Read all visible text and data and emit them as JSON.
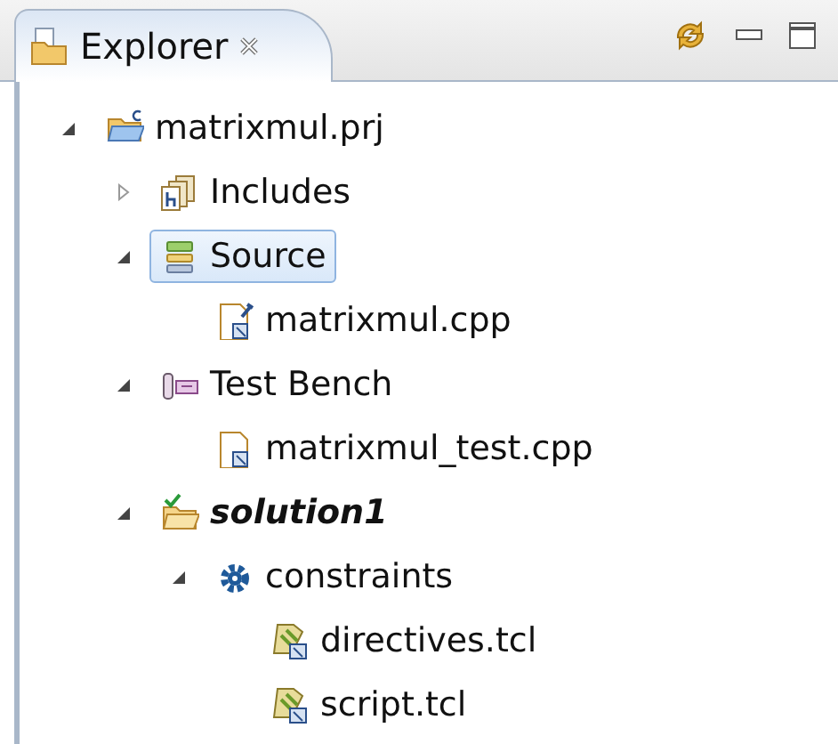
{
  "tab": {
    "label": "Explorer",
    "selected": true,
    "closable": true
  },
  "tree": [
    {
      "label": "matrixmul.prj",
      "kind": "project",
      "expanded": true,
      "selected": false,
      "active": false,
      "children": [
        {
          "label": "Includes",
          "kind": "includes",
          "expanded": false,
          "selected": false,
          "active": false
        },
        {
          "label": "Source",
          "kind": "source",
          "expanded": true,
          "selected": true,
          "active": false,
          "children": [
            {
              "label": "matrixmul.cpp",
              "kind": "cpp",
              "selected": false,
              "active": false
            }
          ]
        },
        {
          "label": "Test Bench",
          "kind": "testbench",
          "expanded": true,
          "selected": false,
          "active": false,
          "children": [
            {
              "label": "matrixmul_test.cpp",
              "kind": "testcpp",
              "selected": false,
              "active": false
            }
          ]
        },
        {
          "label": "solution1",
          "kind": "solution",
          "expanded": true,
          "selected": false,
          "active": true,
          "children": [
            {
              "label": "constraints",
              "kind": "constraints",
              "expanded": true,
              "selected": false,
              "active": false,
              "children": [
                {
                  "label": "directives.tcl",
                  "kind": "tcl",
                  "selected": false,
                  "active": false
                },
                {
                  "label": "script.tcl",
                  "kind": "tcl",
                  "selected": false,
                  "active": false
                }
              ]
            }
          ]
        }
      ]
    }
  ]
}
